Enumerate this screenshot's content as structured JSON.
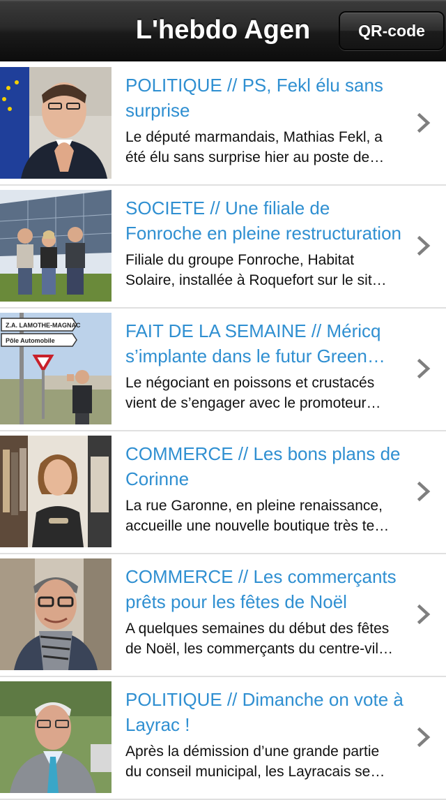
{
  "app": {
    "title": "L'hebdo Agen",
    "qr_button_label": "QR-code"
  },
  "articles": [
    {
      "title_line1": "POLITIQUE // PS, Fekl élu sans",
      "title_line2": "surprise",
      "summary_line1": "Le député marmandais, Mathias Fekl, a",
      "summary_line2": "été élu sans surprise hier au poste de…",
      "thumb_icon": "photo-politician-eu-flag"
    },
    {
      "title_line1": "SOCIETE // Une filiale de",
      "title_line2": "Fonroche en pleine restructuration",
      "summary_line1": "Filiale du groupe Fonroche, Habitat",
      "summary_line2": "Solaire, installée à Roquefort sur le sit…",
      "thumb_icon": "photo-three-people-solar-panels"
    },
    {
      "title_line1": "FAIT DE LA SEMAINE // Méricq",
      "title_line2": "s’implante dans le futur Green…",
      "summary_line1": "Le négociant en poissons et crustacés",
      "summary_line2": "vient de s’engager avec le promoteur…",
      "thumb_icon": "photo-road-signs",
      "sign_top": "Z.A. LAMOTHE-MAGNAC",
      "sign_bottom": "Pôle Automobile"
    },
    {
      "title_line1": "COMMERCE // Les bons plans de",
      "title_line2": "Corinne",
      "summary_line1": "La rue Garonne, en pleine renaissance,",
      "summary_line2": "accueille une nouvelle boutique très te…",
      "thumb_icon": "photo-woman-boutique"
    },
    {
      "title_line1": "COMMERCE // Les commerçants",
      "title_line2": "prêts pour les fêtes de Noël",
      "summary_line1": "A quelques semaines du début des fêtes",
      "summary_line2": "de Noël, les commerçants du centre-vil…",
      "thumb_icon": "photo-man-glasses-scarf"
    },
    {
      "title_line1": "POLITIQUE // Dimanche on vote à",
      "title_line2": "Layrac !",
      "summary_line1": "Après la démission d’une grande partie",
      "summary_line2": "du conseil municipal, les Layracais se…",
      "thumb_icon": "photo-older-man-tie"
    }
  ]
}
